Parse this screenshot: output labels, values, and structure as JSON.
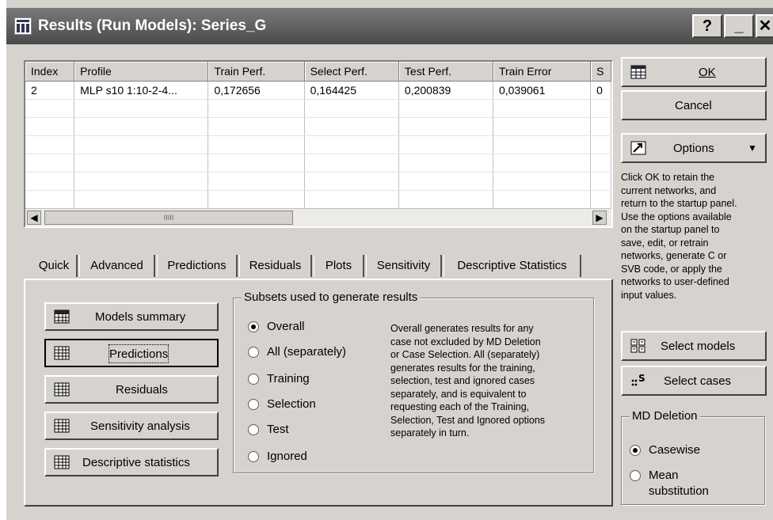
{
  "window": {
    "title": "Results (Run Models): Series_G",
    "help_label": "?",
    "minimize_label": "_",
    "close_label": "✕"
  },
  "grid": {
    "columns": [
      "Index",
      "Profile",
      "Train Perf.",
      "Select Perf.",
      "Test Perf.",
      "Train Error",
      "S"
    ],
    "rows": [
      [
        "2",
        "MLP s10 1:10-2-4...",
        "0,172656",
        "0,164425",
        "0,200839",
        "0,039061",
        "0"
      ]
    ],
    "scroll_thumb_label": "IIIII"
  },
  "tabs": [
    "Quick",
    "Advanced",
    "Predictions",
    "Residuals",
    "Plots",
    "Sensitivity",
    "Descriptive Statistics"
  ],
  "quick": {
    "buttons": [
      "Models summary",
      "Predictions",
      "Residuals",
      "Sensitivity analysis",
      "Descriptive statistics"
    ],
    "subsets": {
      "title": "Subsets used to generate results",
      "options": [
        "Overall",
        "All (separately)",
        "Training",
        "Selection",
        "Test",
        "Ignored"
      ],
      "selected": "Overall",
      "description": [
        "Overall generates results for any",
        "case not excluded by MD Deletion",
        "or Case Selection. All (separately)",
        "generates results for the training,",
        "selection, test and ignored cases",
        "separately, and is equivalent to",
        "requesting each of the Training,",
        "Selection, Test and Ignored options",
        "separately in turn."
      ]
    }
  },
  "side": {
    "ok_label": "OK",
    "cancel_label": "Cancel",
    "options_label": "Options",
    "hint": [
      "Click OK to retain the",
      "current networks, and",
      "return to the startup panel.",
      "Use the options available",
      "on the startup panel to",
      "save, edit, or retrain",
      "networks, generate C or",
      "SVB code, or apply the",
      "networks to user-defined",
      "input values."
    ],
    "select_models_label": "Select models",
    "select_cases_label": "Select cases",
    "md_deletion": {
      "title": "MD Deletion",
      "options": [
        "Casewise",
        "Mean",
        "substitution"
      ],
      "selected": "Casewise"
    }
  },
  "icons": {
    "grid": "grid-icon",
    "summary": "summary-icon",
    "ok": "ok-icon",
    "options": "options-icon",
    "models": "select-models-icon",
    "cases": "select-cases-icon"
  },
  "colors": {
    "face": "#d6d3ce",
    "titlebar": "#5a5a5a",
    "title_text": "#ffffff"
  }
}
